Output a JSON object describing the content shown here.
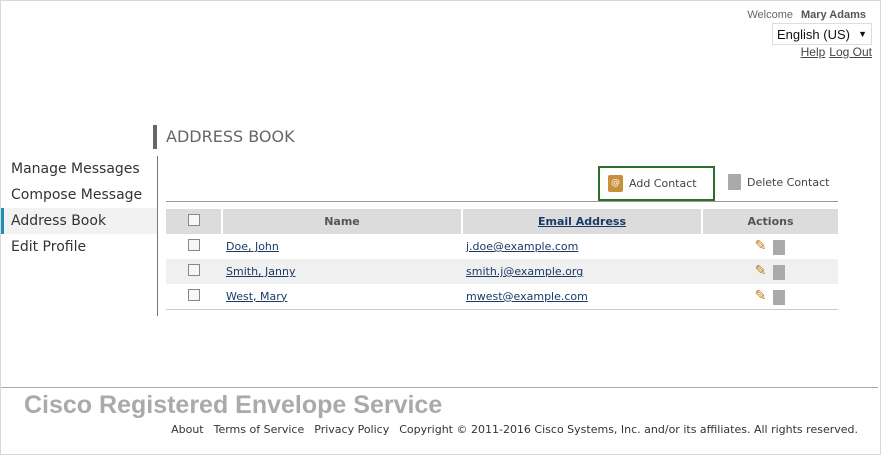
{
  "header": {
    "welcome": "Welcome",
    "user": "Mary Adams",
    "language": "English (US)",
    "help": "Help",
    "logout": "Log Out"
  },
  "sidebar": {
    "items": [
      {
        "label": "Manage Messages"
      },
      {
        "label": "Compose Message"
      },
      {
        "label": "Address Book"
      },
      {
        "label": "Edit Profile"
      }
    ]
  },
  "main": {
    "title": "ADDRESS BOOK",
    "add_contact": "Add Contact",
    "delete_contact": "Delete Contact",
    "columns": {
      "name": "Name",
      "email": "Email Address",
      "actions": "Actions"
    },
    "rows": [
      {
        "name": "Doe, John",
        "email": "j.doe@example.com"
      },
      {
        "name": "Smith, Janny",
        "email": "smith.j@example.org"
      },
      {
        "name": "West, Mary",
        "email": "mwest@example.com"
      }
    ]
  },
  "footer": {
    "brand": "Cisco Registered Envelope Service",
    "about": "About",
    "terms": "Terms of Service",
    "privacy": "Privacy Policy",
    "copyright": "Copyright © 2011-2016 Cisco Systems, Inc. and/or its affiliates. All rights reserved."
  }
}
